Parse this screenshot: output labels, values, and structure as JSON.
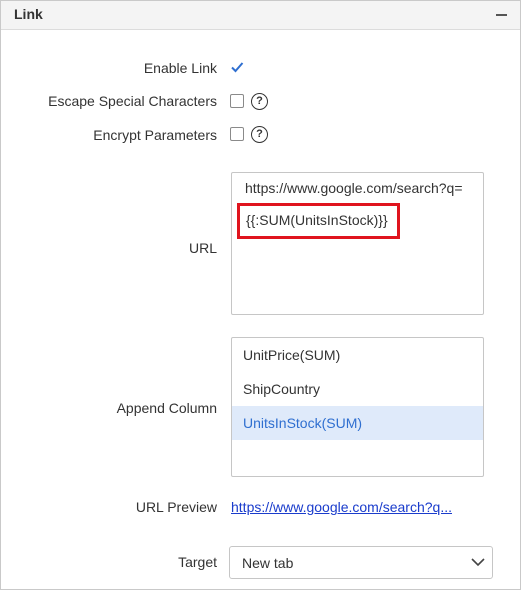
{
  "panel": {
    "title": "Link"
  },
  "fields": {
    "enable_link": {
      "label": "Enable Link",
      "checked": true
    },
    "escape_special": {
      "label": "Escape Special Characters",
      "checked": false,
      "help": "?"
    },
    "encrypt_params": {
      "label": "Encrypt Parameters",
      "checked": false,
      "help": "?"
    },
    "url": {
      "label": "URL",
      "value_line1": "https://www.google.com/search?q=",
      "value_line2": "{{:SUM(UnitsInStock)}}"
    },
    "append_column": {
      "label": "Append Column",
      "items": [
        {
          "label": "UnitPrice(SUM)",
          "selected": false
        },
        {
          "label": "ShipCountry",
          "selected": false
        },
        {
          "label": "UnitsInStock(SUM)",
          "selected": true
        }
      ]
    },
    "url_preview": {
      "label": "URL Preview",
      "link_text": "https://www.google.com/search?q..."
    },
    "target": {
      "label": "Target",
      "value": "New tab"
    }
  },
  "colors": {
    "accent": "#2f6fd0",
    "highlight_border": "#e0141e",
    "selected_bg": "#dfeafa",
    "link": "#1a3ccc"
  }
}
